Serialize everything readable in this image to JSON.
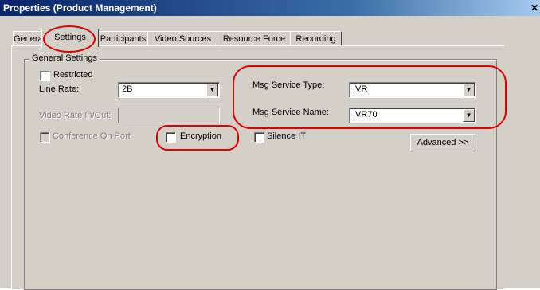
{
  "window": {
    "title": "Properties  (Product Management)",
    "close_label": "✕"
  },
  "tabs": [
    {
      "label": "General"
    },
    {
      "label": "Settings"
    },
    {
      "label": "Participants"
    },
    {
      "label": "Video Sources"
    },
    {
      "label": "Resource Force"
    },
    {
      "label": "Recording"
    }
  ],
  "group": {
    "label": "General Settings"
  },
  "form": {
    "restricted_label": "Restricted",
    "line_rate_label": "Line Rate:",
    "line_rate_value": "2B",
    "video_rate_label": "Video Rate In/Out:",
    "video_rate_value": "",
    "conference_on_port_label": "Conference On Port",
    "encryption_label": "Encryption",
    "silence_it_label": "Silence IT",
    "msg_service_type_label": "Msg Service Type:",
    "msg_service_type_value": "IVR",
    "msg_service_name_label": "Msg Service Name:",
    "msg_service_name_value": "IVR70",
    "advanced_label": "Advanced >>"
  },
  "highlight_color": "#e00000"
}
